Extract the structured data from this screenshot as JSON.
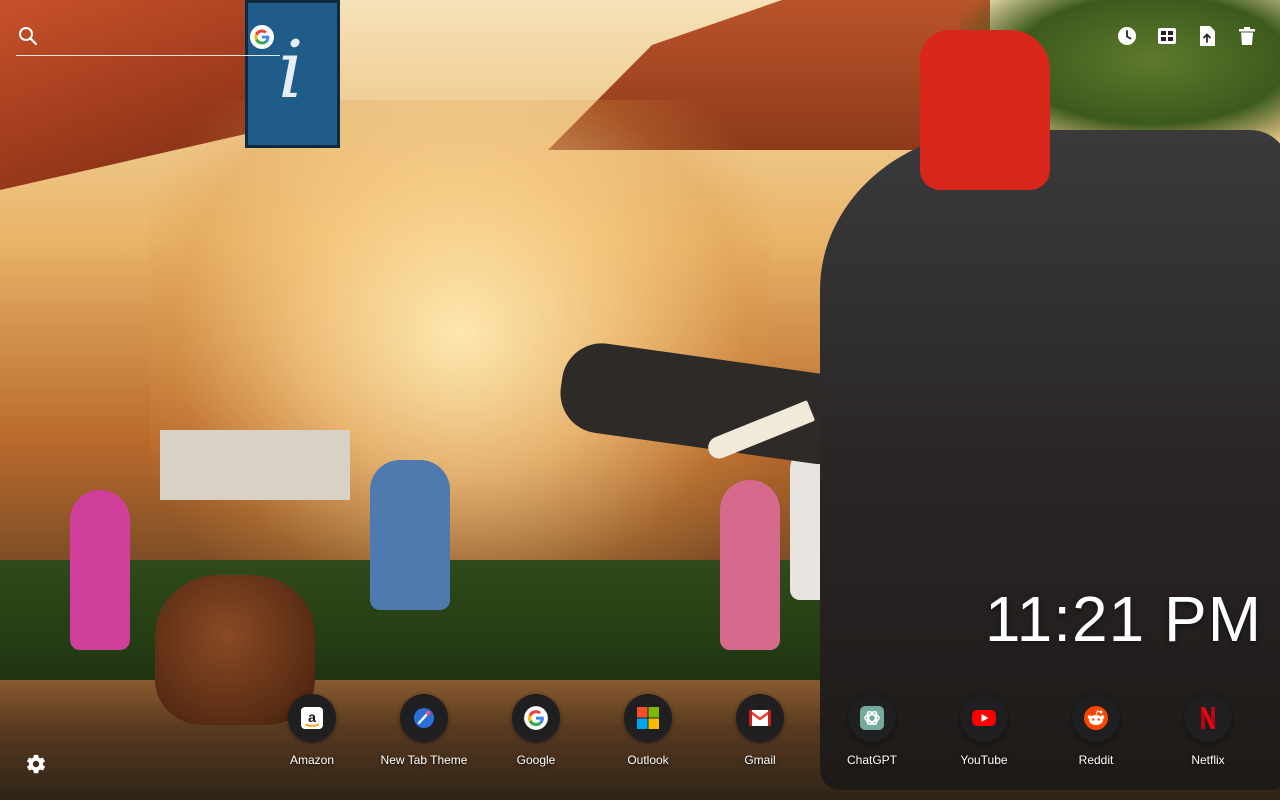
{
  "search": {
    "placeholder": "",
    "engine_icon": "google-icon"
  },
  "toolbar": {
    "items": [
      {
        "icon": "clock-icon"
      },
      {
        "icon": "apps-grid-icon"
      },
      {
        "icon": "file-upload-icon"
      },
      {
        "icon": "trash-icon"
      }
    ]
  },
  "clock": {
    "time": "11:21 PM"
  },
  "shortcuts": [
    {
      "label": "Amazon",
      "icon": "amazon-icon"
    },
    {
      "label": "New Tab Theme",
      "icon": "new-tab-theme-icon"
    },
    {
      "label": "Google",
      "icon": "google-icon"
    },
    {
      "label": "Outlook",
      "icon": "microsoft-icon"
    },
    {
      "label": "Gmail",
      "icon": "gmail-icon"
    },
    {
      "label": "ChatGPT",
      "icon": "chatgpt-icon"
    },
    {
      "label": "YouTube",
      "icon": "youtube-icon"
    },
    {
      "label": "Reddit",
      "icon": "reddit-icon"
    },
    {
      "label": "Netflix",
      "icon": "netflix-icon"
    }
  ],
  "settings": {
    "icon": "gear-icon"
  },
  "colors": {
    "google_blue": "#4285F4",
    "google_red": "#EA4335",
    "google_yellow": "#FBBC05",
    "google_green": "#34A853",
    "youtube_red": "#FF0000",
    "reddit_orange": "#FF4500",
    "netflix_red": "#E50914",
    "chatgpt_teal": "#74AA9C"
  }
}
